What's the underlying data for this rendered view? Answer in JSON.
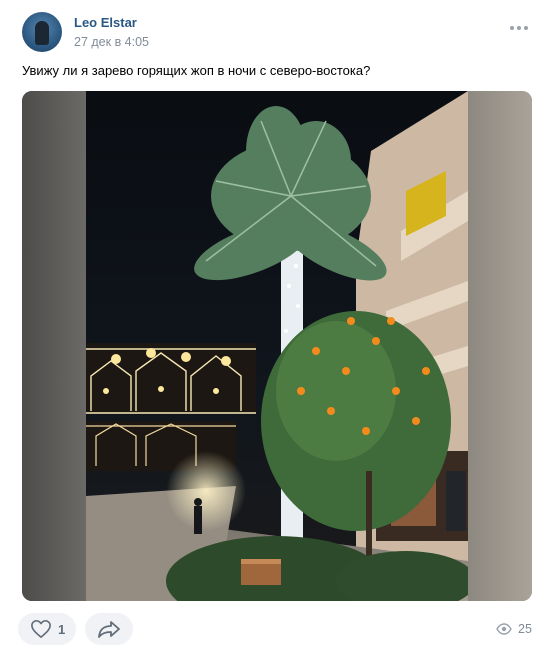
{
  "post": {
    "author": "Leo Elstar",
    "date": "27 дек в 4:05",
    "text": "Увижу ли я зарево горящих жоп в ночи с северо-востока?"
  },
  "actions": {
    "likes": "1",
    "views": "25"
  },
  "icons": {
    "more": "more-horizontal-icon",
    "like": "heart-icon",
    "share": "share-arrow-icon",
    "views": "eye-icon"
  },
  "colors": {
    "author": "#2a5885",
    "meta": "#818c99",
    "button_bg": "#f0f2f5"
  }
}
